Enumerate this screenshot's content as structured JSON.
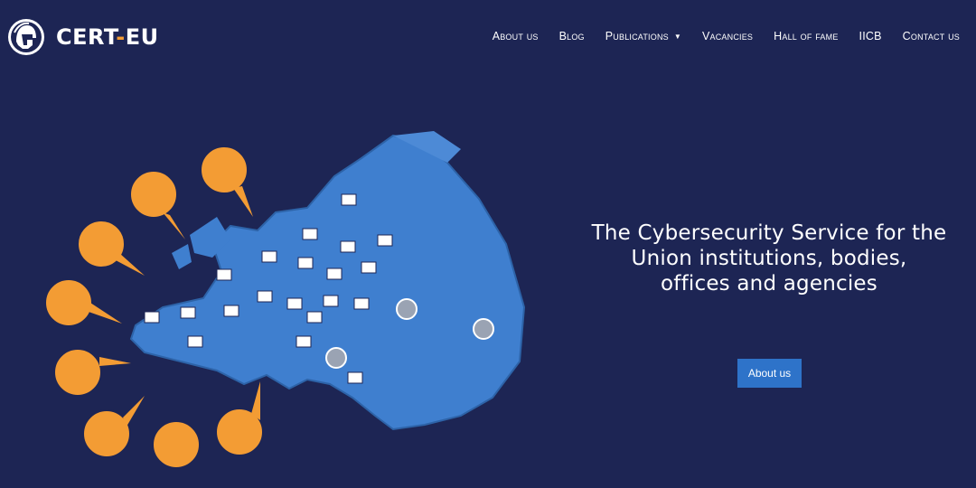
{
  "brand": {
    "name_part1": "CERT",
    "name_dash": "-",
    "name_part2": "EU"
  },
  "nav": {
    "items": [
      {
        "label": "About us"
      },
      {
        "label": "Blog"
      },
      {
        "label": "Publications"
      },
      {
        "label": "Vacancies"
      },
      {
        "label": "Hall of fame"
      },
      {
        "label": "IICB"
      },
      {
        "label": "Contact us"
      }
    ]
  },
  "hero": {
    "tagline_line1": "The Cybersecurity Service for the",
    "tagline_line2": "Union institutions, bodies,",
    "tagline_line3": "offices and agencies",
    "cta_label": "About us"
  },
  "colors": {
    "background": "#1d2554",
    "accent": "#f39c34",
    "map_blue": "#3f7fcf",
    "button": "#2e73c9"
  }
}
